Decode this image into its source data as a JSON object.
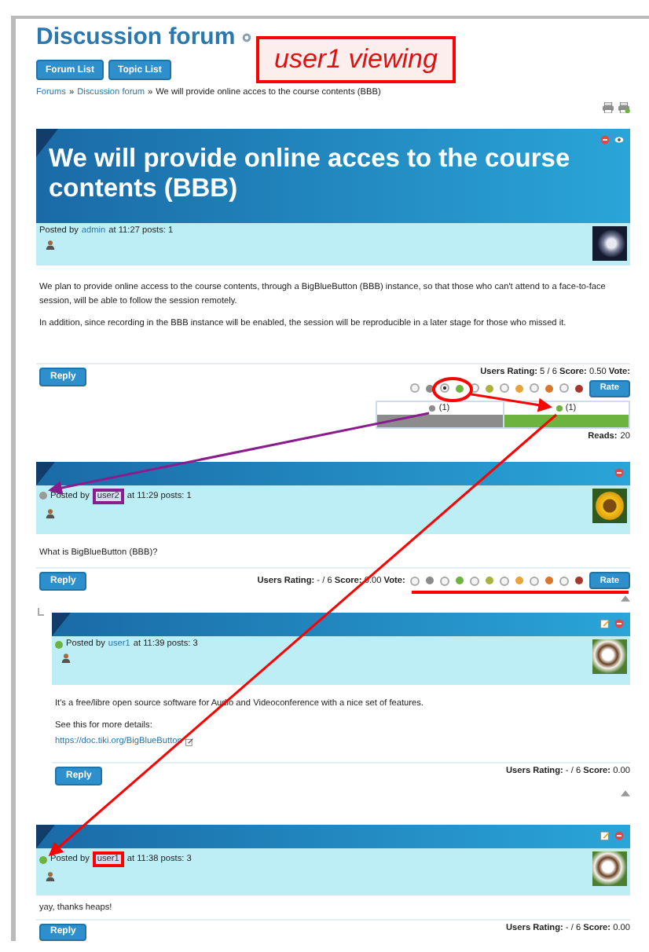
{
  "page_title": "Discussion forum",
  "annotation_label": "user1 viewing",
  "nav_buttons": [
    "Forum List",
    "Topic List"
  ],
  "breadcrumb": {
    "links": [
      "Forums",
      "Discussion forum"
    ],
    "separator": "»",
    "current": "We will provide online acces to the course contents (BBB)"
  },
  "topic": {
    "title": "We will provide online acces to the course contents (BBB)",
    "actions": [
      {
        "kind": "delete"
      },
      {
        "kind": "watch"
      }
    ],
    "posted_by": "Posted by",
    "author": "admin",
    "meta": "at 11:27 posts: 1",
    "avatar": {
      "kind": "astronaut"
    },
    "paragraphs": [
      "We plan to provide online access to the course contents, through a BigBlueButton (BBB) instance, so that those who can't attend to a face-to-face session, will be able to follow the session remotely.",
      "In addition, since recording in the BBB instance will be enabled, the session will be reproducible in a later stage for those who missed it."
    ],
    "reply_button": "Reply",
    "rating": "**Users Rating:** 5 / 6 **Score:** 0.50 **Vote:**",
    "vote_options": [
      {
        "color": "#8c8c8c",
        "selected": false
      },
      {
        "color": "#6db33f",
        "selected": true
      },
      {
        "color": "#a9b23a",
        "selected": false
      },
      {
        "color": "#eaa23a",
        "selected": false
      },
      {
        "color": "#d9772e",
        "selected": false
      },
      {
        "color": "#a8362c",
        "selected": false
      }
    ],
    "rate_button": "Rate",
    "results": [
      {
        "color": "#8c8c8c",
        "count": "(1)",
        "level": 1
      },
      {
        "color": "#6db33f",
        "count": "(1)",
        "level": 1
      }
    ],
    "reads_label": "Reads:",
    "reads": "20"
  },
  "replies": [
    {
      "actions": [
        {
          "kind": "delete"
        }
      ],
      "online": false,
      "posted_by": "Posted by",
      "author": "user2",
      "author_annotation": {
        "color": "#8b1e8f"
      },
      "meta": "at 11:29 posts: 1",
      "avatar": {
        "kind": "flower"
      },
      "paragraphs": [
        "What is BigBlueButton (BBB)?"
      ],
      "reply_button": "Reply",
      "rating": "**Users Rating:** - / 6 **Score:** 0.00 **Vote:**",
      "vote_options": [
        {
          "color": "#8c8c8c",
          "selected": false
        },
        {
          "color": "#6db33f",
          "selected": false
        },
        {
          "color": "#a9b23a",
          "selected": false
        },
        {
          "color": "#eaa23a",
          "selected": false
        },
        {
          "color": "#d9772e",
          "selected": false
        },
        {
          "color": "#a8362c",
          "selected": false
        }
      ],
      "rate_button": "Rate",
      "top_link": true,
      "children": [
        {
          "actions": [
            {
              "kind": "edit"
            },
            {
              "kind": "delete"
            }
          ],
          "online": true,
          "posted_by": "Posted by",
          "author": "user1",
          "meta": "at 11:39 posts: 3",
          "avatar": {
            "kind": "dog"
          },
          "paragraphs": [
            "It's a free/libre open source software for Audio and Videoconference with a nice set of features.",
            "See this for more details:"
          ],
          "link": "https://doc.tiki.org/BigBlueButton",
          "reply_button": "Reply",
          "rating": "**Users Rating:** - / 6 **Score:** 0.00",
          "top_link": true
        }
      ]
    },
    {
      "actions": [
        {
          "kind": "edit"
        },
        {
          "kind": "delete"
        }
      ],
      "online": true,
      "posted_by": "Posted by",
      "author": "user1",
      "author_annotation": {
        "color": "#ff0000"
      },
      "meta": "at 11:38 posts: 3",
      "avatar": {
        "kind": "dog"
      },
      "paragraphs": [
        "yay, thanks heaps!"
      ],
      "reply_button": "Reply",
      "rating": "**Users Rating:** - / 6 **Score:** 0.00"
    }
  ]
}
